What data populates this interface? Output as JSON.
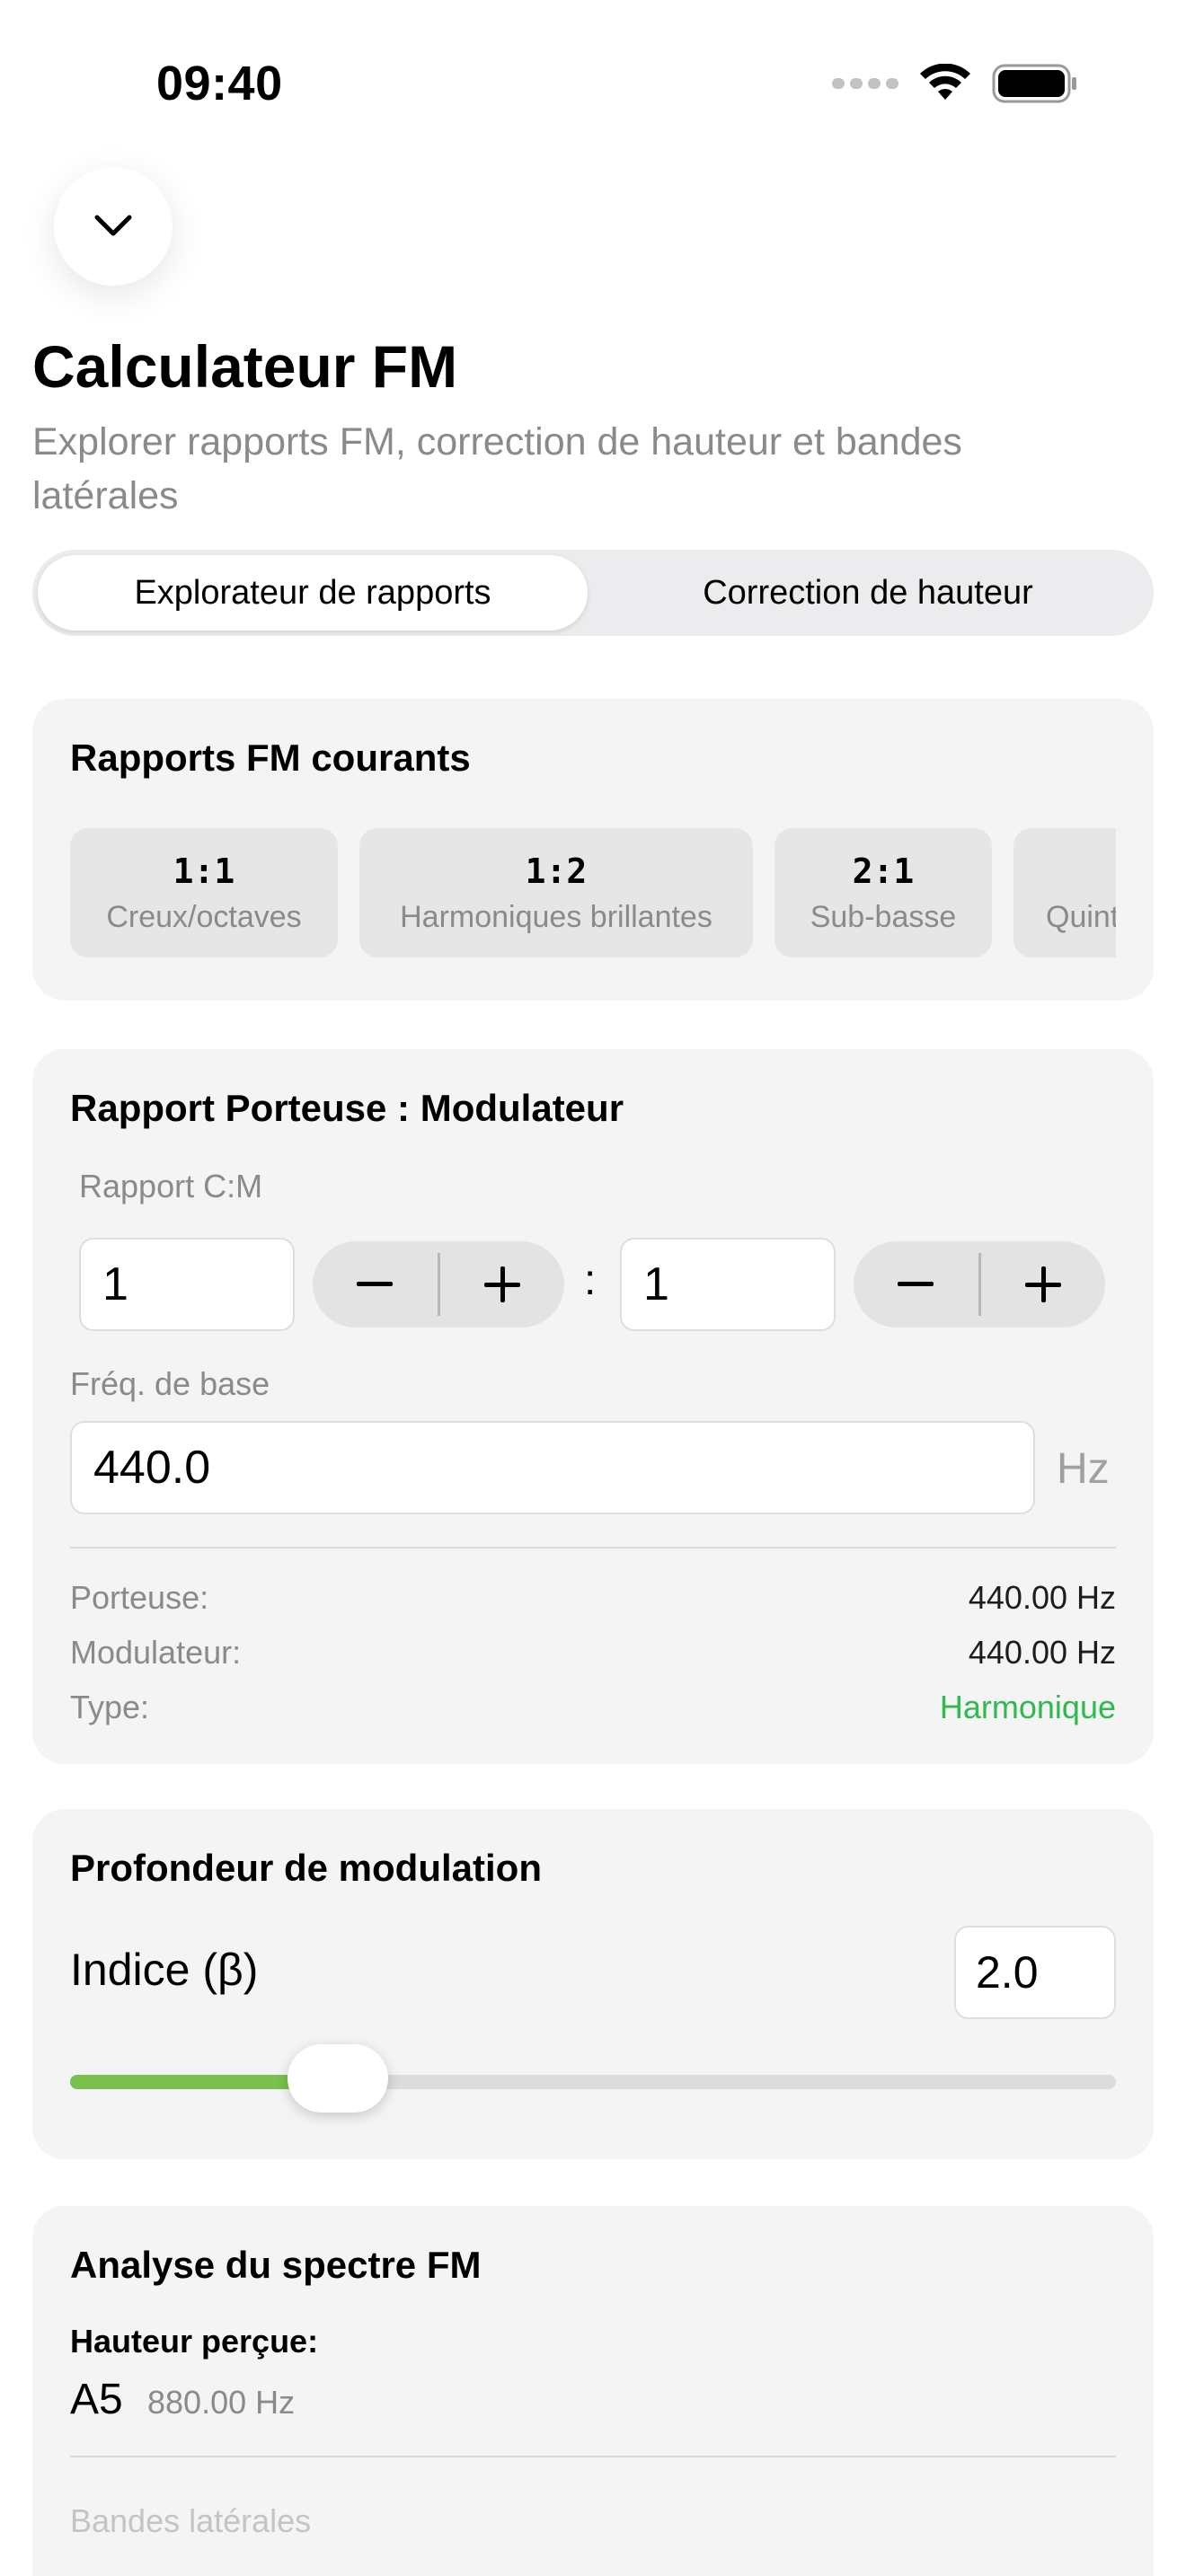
{
  "status_bar": {
    "time": "09:40"
  },
  "header": {
    "title": "Calculateur FM",
    "subtitle": "Explorer rapports FM, correction de hauteur et bandes latérales"
  },
  "tabs": [
    {
      "label": "Explorateur de rapports",
      "active": true
    },
    {
      "label": "Correction de hauteur",
      "active": false
    }
  ],
  "common_ratios": {
    "title": "Rapports FM courants",
    "items": [
      {
        "ratio": "1:1",
        "desc": "Creux/octaves"
      },
      {
        "ratio": "1:2",
        "desc": "Harmoniques brillantes"
      },
      {
        "ratio": "2:1",
        "desc": "Sub-basse"
      },
      {
        "ratio": "",
        "desc": "Quint"
      }
    ]
  },
  "ratio_card": {
    "title": "Rapport Porteuse : Modulateur",
    "cm_label": "Rapport C:M",
    "carrier_value": "1",
    "modulator_value": "1",
    "colon": ":",
    "base_freq_label": "Fréq. de base",
    "base_freq_value": "440.0",
    "unit": "Hz",
    "rows": [
      {
        "label": "Porteuse:",
        "value": "440.00 Hz"
      },
      {
        "label": "Modulateur:",
        "value": "440.00 Hz"
      },
      {
        "label": "Type:",
        "value": "Harmonique"
      }
    ],
    "type_color": "#2fb94e"
  },
  "depth_card": {
    "title": "Profondeur de modulation",
    "index_label": "Indice (β)",
    "index_value": "2.0",
    "slider_fraction": 0.23,
    "slider_color": "#79c14f"
  },
  "spectrum_card": {
    "title": "Analyse du spectre FM",
    "perceived_label": "Hauteur perçue:",
    "note": "A5",
    "note_freq": "880.00 Hz",
    "sidebands_label": "Bandes latérales"
  }
}
